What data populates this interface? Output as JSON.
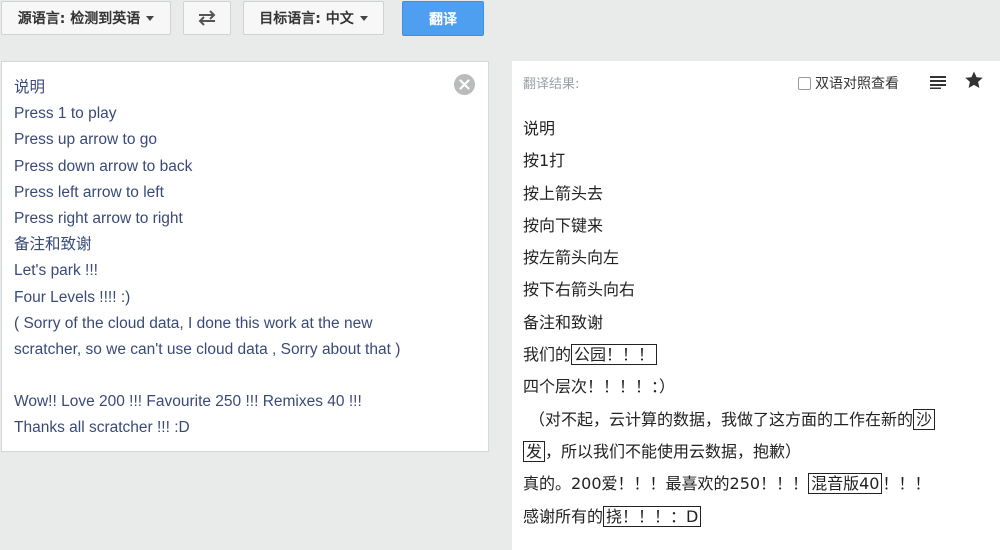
{
  "toolbar": {
    "source_lang": "源语言: 检测到英语",
    "swap_icon": "swap-arrows-icon",
    "target_lang": "目标语言: 中文",
    "translate": "翻译"
  },
  "source": {
    "lines": [
      "说明",
      "Press 1 to play",
      "Press up arrow to go",
      "Press down arrow to back",
      "Press left arrow to left",
      "Press right arrow to right",
      "备注和致谢",
      "Let's park !!!",
      "Four Levels !!!! :)",
      "( Sorry of the cloud data, I done this work at the new",
      "scratcher, so we can't use cloud data , Sorry about that )",
      "",
      "Wow!! Love 200 !!! Favourite 250 !!! Remixes 40 !!!",
      "Thanks all scratcher !!! :D"
    ],
    "clear_icon": "clear-x-icon"
  },
  "result": {
    "label": "翻译结果:",
    "bilingual_label": "双语对照查看",
    "list_icon": "list-icon",
    "star_icon": "star-icon",
    "lines": {
      "l0": "说明",
      "l1": "按1打",
      "l2": "按上箭头去",
      "l3": "按向下键来",
      "l4": "按左箭头向左",
      "l5": "按下右箭头向右",
      "l6": "备注和致谢",
      "l7a": "我们的",
      "l7b": "公园！！！",
      "l8": "四个层次！！！！：）",
      "l9a": "（对不起，云计算的数据，我做了这方面的工作在新的",
      "l9b": "沙",
      "l10a": "发",
      "l10b": "，所以我们不能使用云数据，抱歉）",
      "l11a": "真的。200爱！！！最喜欢的250！！！",
      "l11b": "混音版40",
      "l11c": "！！！",
      "l12a": "感谢所有的",
      "l12b": "挠！！！：D"
    }
  },
  "colors": {
    "translate_button": "#4f9ff0",
    "source_text": "#3a4a78",
    "background": "#e8ebe9"
  }
}
